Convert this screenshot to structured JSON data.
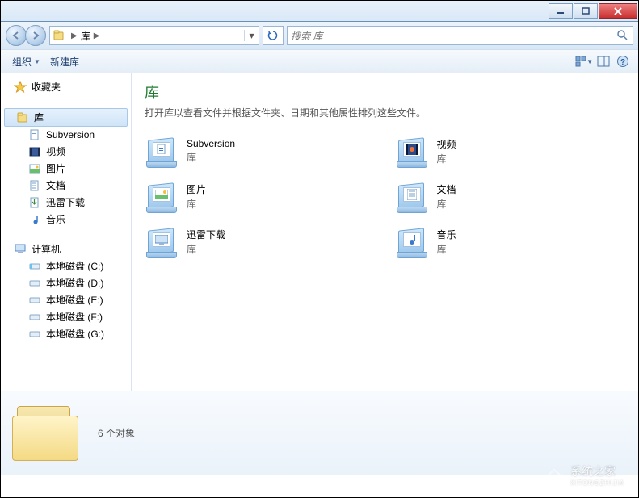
{
  "window": {
    "min_tip": "最小化",
    "max_tip": "最大化",
    "close_tip": "关闭"
  },
  "breadcrumb": {
    "root": "库"
  },
  "search": {
    "placeholder": "搜索 库"
  },
  "toolbar": {
    "organize": "组织",
    "new_library": "新建库"
  },
  "sidebar": {
    "favorites": "收藏夹",
    "libraries": "库",
    "lib_items": [
      {
        "label": "Subversion"
      },
      {
        "label": "视频"
      },
      {
        "label": "图片"
      },
      {
        "label": "文档"
      },
      {
        "label": "迅雷下载"
      },
      {
        "label": "音乐"
      }
    ],
    "computer": "计算机",
    "drives": [
      {
        "label": "本地磁盘 (C:)"
      },
      {
        "label": "本地磁盘 (D:)"
      },
      {
        "label": "本地磁盘 (E:)"
      },
      {
        "label": "本地磁盘 (F:)"
      },
      {
        "label": "本地磁盘 (G:)"
      }
    ]
  },
  "content": {
    "title": "库",
    "subtitle": "打开库以查看文件并根据文件夹、日期和其他属性排列这些文件。",
    "type_label": "库",
    "items": [
      {
        "name": "Subversion"
      },
      {
        "name": "视频"
      },
      {
        "name": "图片"
      },
      {
        "name": "文档"
      },
      {
        "name": "迅雷下载"
      },
      {
        "name": "音乐"
      }
    ]
  },
  "details": {
    "summary": "6 个对象"
  },
  "watermark": {
    "text": "系统之家",
    "sub": "XITONGZHIJIA"
  },
  "colors": {
    "accent": "#1f7a2f"
  }
}
